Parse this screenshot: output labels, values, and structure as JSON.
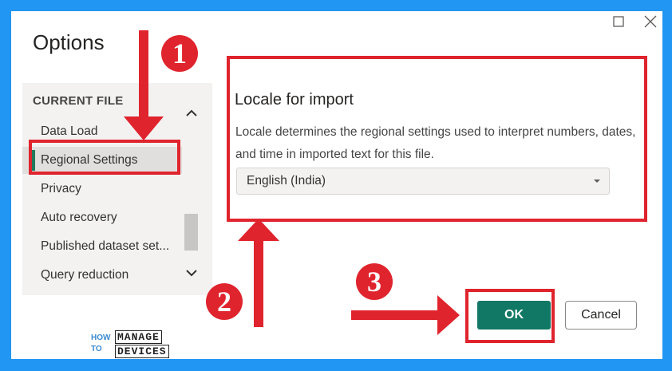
{
  "dialog": {
    "title": "Options",
    "window_controls": [
      "restore-icon",
      "close-icon"
    ]
  },
  "sidebar": {
    "section_label": "CURRENT FILE",
    "items": [
      {
        "label": "Data Load",
        "selected": false
      },
      {
        "label": "Regional Settings",
        "selected": true
      },
      {
        "label": "Privacy",
        "selected": false
      },
      {
        "label": "Auto recovery",
        "selected": false
      },
      {
        "label": "Published dataset set...",
        "selected": false
      },
      {
        "label": "Query reduction",
        "selected": false
      }
    ]
  },
  "content": {
    "heading": "Locale for import",
    "description": "Locale determines the regional settings used to interpret numbers, dates, and time in imported text for this file.",
    "locale_select": {
      "value": "English (India)"
    }
  },
  "buttons": {
    "ok": "OK",
    "cancel": "Cancel"
  },
  "annotations": {
    "step_numbers": [
      "1",
      "2",
      "3"
    ],
    "color": "#e0242d"
  },
  "logo": {
    "how": "HOW",
    "to": "TO",
    "manage": "MANAGE",
    "devices": "DEVICES"
  },
  "colors": {
    "frame": "#2196f3",
    "accent": "#117865"
  }
}
